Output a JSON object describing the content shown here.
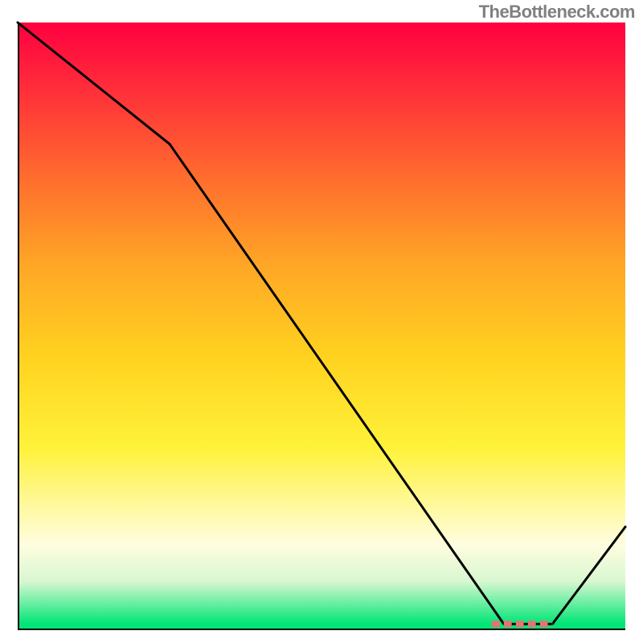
{
  "attribution": "TheBottleneck.com",
  "chart_data": {
    "type": "line",
    "title": "",
    "xlabel": "",
    "ylabel": "",
    "xlim": [
      0,
      100
    ],
    "ylim": [
      0,
      100
    ],
    "series": [
      {
        "name": "curve",
        "x": [
          0,
          25,
          80,
          88,
          100
        ],
        "values": [
          100,
          80,
          1,
          1,
          17
        ]
      }
    ],
    "marker_segment": {
      "x_start": 78,
      "x_end": 88,
      "y": 1
    }
  }
}
